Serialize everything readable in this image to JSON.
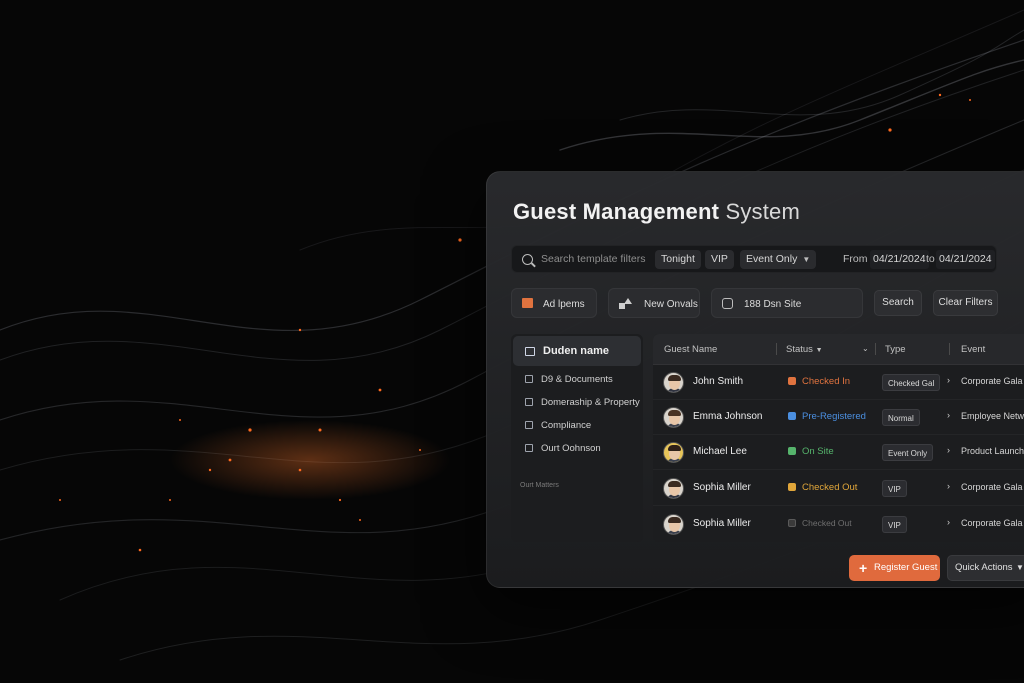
{
  "colors": {
    "accent": "#e06a3d",
    "checked_in": "#e0733f",
    "pre_registered": "#4b8fe0",
    "on_site": "#56b46c",
    "checked_out": "#e0a63a",
    "checked_out_muted": "#6f6f6f"
  },
  "title": {
    "bold": "Guest Management",
    "light": "System"
  },
  "search": {
    "placeholder": "Search template filters"
  },
  "filters": {
    "tonight": "Tonight",
    "vip": "VIP",
    "event_only": "Event Only",
    "from_label": "From",
    "from_date": "04/21/2024",
    "to_label": "to",
    "to_date": "04/21/2024"
  },
  "quick_buttons": {
    "ad_items": "Ad lpems",
    "new_onvals": "New Onvals",
    "site": "188 Dsn Site"
  },
  "actions": {
    "search": "Search",
    "clear": "Clear Filters"
  },
  "sidebar": {
    "header": "Duden name",
    "items": [
      "D9 & Documents",
      "Domeraship & Property",
      "Compliance",
      "Ourt Oohnson"
    ],
    "footer": "Ourt Matters"
  },
  "table": {
    "columns": {
      "name": "Guest Name",
      "status": "Status",
      "type": "Type",
      "event": "Event"
    },
    "rows": [
      {
        "name": "John Smith",
        "status": "Checked In",
        "type": "Checked Gal",
        "event": "Corporate Gala"
      },
      {
        "name": "Emma Johnson",
        "status": "Pre-Registered",
        "type": "Normal",
        "event": "Employee Networ"
      },
      {
        "name": "Michael Lee",
        "status": "On Site",
        "type": "Event Only",
        "event": "Product Launch"
      },
      {
        "name": "Sophia Miller",
        "status": "Checked Out",
        "type": "VIP",
        "event": "Corporate Gala"
      },
      {
        "name": "Sophia Miller",
        "status": "Checked Out",
        "type": "VIP",
        "event": "Corporate Gala"
      }
    ]
  },
  "footer": {
    "register": "Register Guest",
    "quick_actions": "Quick Actions"
  }
}
